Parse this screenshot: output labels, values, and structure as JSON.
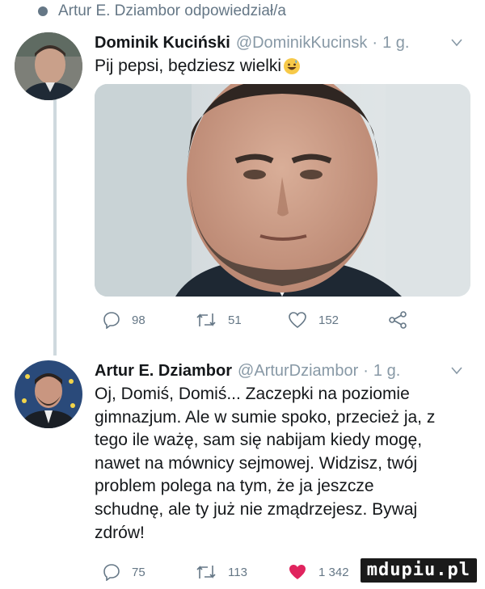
{
  "context": {
    "text": "Artur E. Dziambor odpowiedział/a"
  },
  "tweet1": {
    "name": "Dominik Kuciński",
    "handle": "@DominikKucinsk",
    "time": "1 g.",
    "text": "Pij pepsi, będziesz wielki",
    "emoji_icon": "grinning-sweat-emoji-icon",
    "reply_count": "98",
    "retweet_count": "51",
    "like_count": "152"
  },
  "tweet2": {
    "name": "Artur E. Dziambor",
    "handle": "@ArturDziambor",
    "time": "1 g.",
    "lines": [
      "Oj, Domiś, Domiś... Zaczepki na poziomie",
      "gimnazjum. Ale w sumie spoko, przecież ja, z",
      "tego ile ważę, sam się nabijam kiedy mogę,",
      "nawet na mównicy sejmowej. Widzisz, twój",
      "problem polega na tym, że ja jeszcze",
      "schudnę, ale ty już nie zmądrzejesz. Bywaj",
      "zdrów!"
    ],
    "reply_count": "75",
    "retweet_count": "113",
    "like_count": "1 342"
  },
  "watermark": "mdupiu.pl",
  "colors": {
    "secondary": "#657786",
    "like_active": "#e0245e",
    "thread_line": "#cfd9de"
  }
}
